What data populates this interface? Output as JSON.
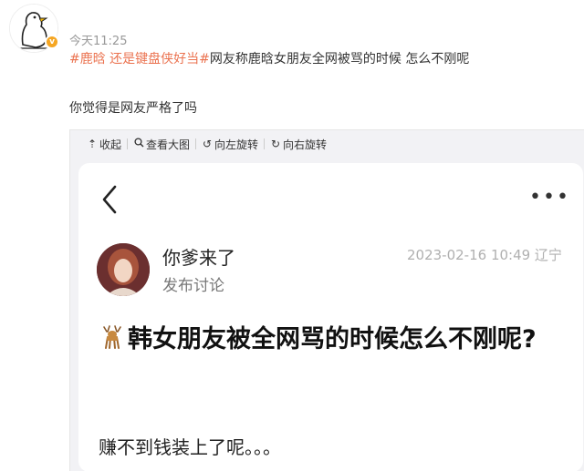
{
  "post": {
    "time": "今天11:25",
    "tag1": "#鹿晗 还是键盘侠好当#",
    "headline_rest": "网友称鹿晗女朋友全网被骂的时候 怎么不刚呢",
    "question": "你觉得是网友严格了吗"
  },
  "viewer": {
    "toolbar": [
      {
        "icon": "collapse-icon",
        "label": "收起"
      },
      {
        "icon": "magnify-icon",
        "label": "查看大图"
      },
      {
        "icon": "rotate-left-icon",
        "label": "向左旋转"
      },
      {
        "icon": "rotate-right-icon",
        "label": "向右旋转"
      }
    ]
  },
  "screenshot": {
    "username": "你爹来了",
    "user_sub": "发布讨论",
    "meta": "2023-02-16 10:49 辽宁",
    "title": "韩女朋友被全网骂的时候怎么不刚呢?",
    "body": "赚不到钱装上了呢。。。"
  },
  "colors": {
    "tag": "#eb7350",
    "badge": "#f5a623"
  }
}
